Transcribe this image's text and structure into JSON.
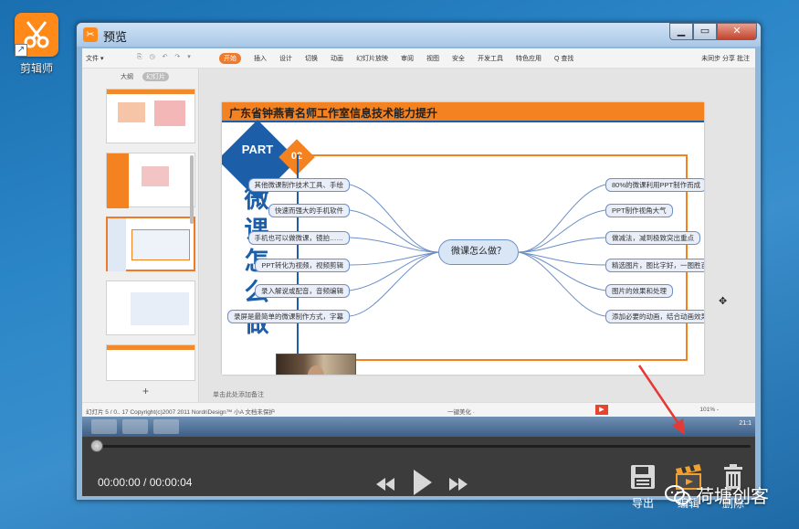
{
  "desktop": {
    "icon_label": "剪辑师"
  },
  "window": {
    "title": "预览",
    "app_icon": "scissors-icon",
    "buttons": [
      "minimize",
      "maximize",
      "close"
    ]
  },
  "video_frame": {
    "ribbon": {
      "left": "文件 ▾",
      "tabs": [
        "开始",
        "插入",
        "设计",
        "切换",
        "动画",
        "幻灯片放映",
        "审阅",
        "视图",
        "安全",
        "开发工具",
        "特色应用"
      ],
      "active_tab": "开始",
      "search": "Q 查找",
      "right": "未同步  分享  批注"
    },
    "thumb_tabs": [
      "大纲",
      "幻灯片"
    ],
    "slide": {
      "header": "广东省钟燕青名师工作室信息技术能力提升",
      "part_label": "PART",
      "part_num": "02",
      "vertical_title": "微课怎么做",
      "center": "微课怎么做？",
      "left_nodes": [
        "其他微课制作技术工具、手绘",
        "快速而强大的手机软件",
        "手机也可以做微课，镜拍……",
        "PPT转化为视频，视频剪辑",
        "录入解说或配音，音频编辑",
        "录屏是最简单的微课制作方式，字幕"
      ],
      "right_nodes": [
        "80%的微课利用PPT制作而成",
        "PPT制作视角大气",
        "做减法，减到极致突出重点",
        "精选图片，图比字好，一图胜百字",
        "图片的效果和处理",
        "添加必要的动画，结合动画效果"
      ]
    },
    "notes": "单击此处添加备注",
    "status_left": "幻灯片 5 / 0.. 17    Copyright(c)2007 2011 NordriDesign™ 小A    文档未保护",
    "status_mid": "一键美化 ·",
    "zoom": "101% -",
    "clock": "21:1"
  },
  "player": {
    "timecode": "00:00:00 / 00:00:04",
    "actions": [
      {
        "label": "导出",
        "icon": "save-icon"
      },
      {
        "label": "编辑",
        "icon": "clapperboard-icon"
      },
      {
        "label": "删除",
        "icon": "trash-icon"
      }
    ],
    "annotation_color": "#e53935"
  },
  "watermark": "荷塘创客"
}
